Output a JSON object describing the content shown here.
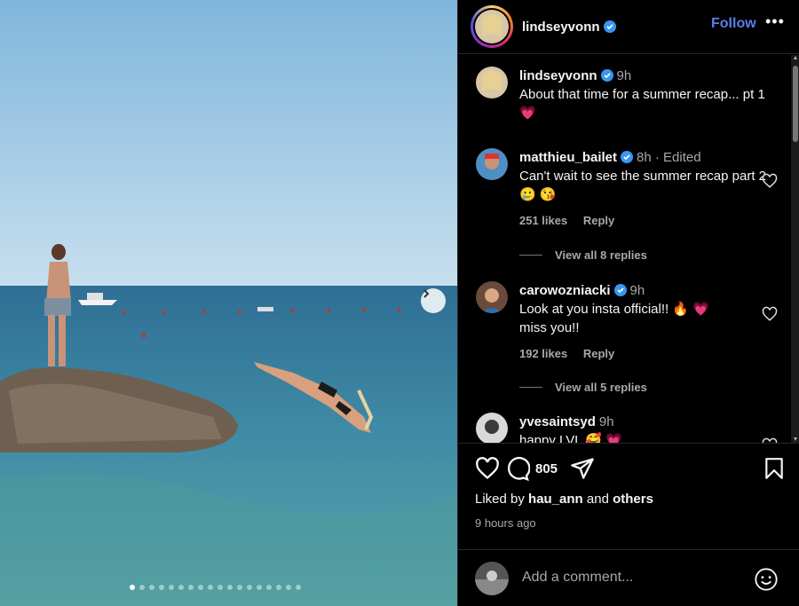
{
  "post": {
    "username": "lindseyvonn",
    "follow_label": "Follow",
    "more_label": "•••",
    "caption": {
      "username": "lindseyvonn",
      "time": "9h",
      "text": "About that time for a summer recap... pt 1",
      "emoji": "💗"
    },
    "image_alt": "Photo of a man standing on a rock and a woman diving into the sea"
  },
  "comments": [
    {
      "username": "matthieu_bailet",
      "verified": true,
      "time": "8h · Edited",
      "text": "Can't wait to see the summer recap part 2",
      "emojis": "🥲 😘",
      "likes": "251 likes",
      "reply": "Reply",
      "view_replies": "View all 8 replies"
    },
    {
      "username": "carowozniacki",
      "verified": true,
      "time": "9h",
      "text": "Look at you insta official!!",
      "emojis": "🔥 💗",
      "text2": "miss you!!",
      "likes": "192 likes",
      "reply": "Reply",
      "view_replies": "View all 5 replies"
    },
    {
      "username": "yvesaintsyd",
      "verified": false,
      "time": "9h",
      "text": "happy LVL",
      "emojis": "🥰 💗"
    }
  ],
  "actions": {
    "comment_count": "805",
    "liked_prefix": "Liked by",
    "liked_user": "hau_ann",
    "liked_and": "and",
    "liked_others": "others",
    "time_ago": "9 hours ago"
  },
  "add_comment": {
    "placeholder": "Add a comment..."
  },
  "carousel": {
    "slide_count": 18,
    "active_index": 0
  },
  "colors": {
    "accent": "#5c7ce8",
    "verified": "#3897f0",
    "background": "#000000"
  }
}
